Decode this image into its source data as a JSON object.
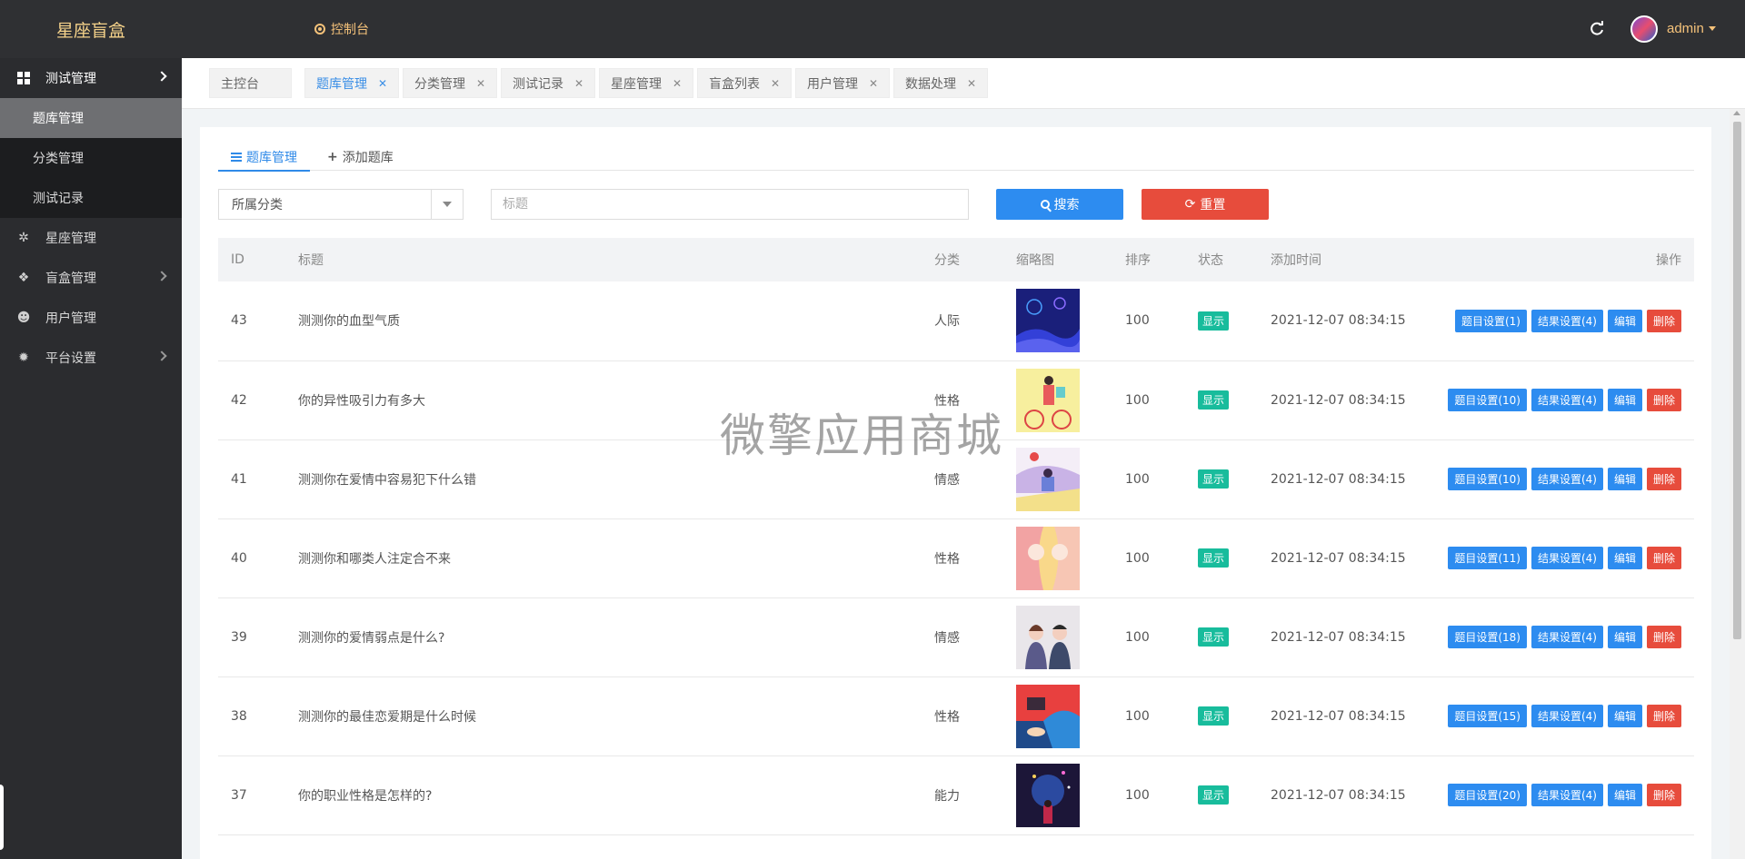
{
  "header": {
    "brand": "星座盲盒",
    "console_label": "控制台",
    "user_name": "admin"
  },
  "sidebar": {
    "items": [
      {
        "label": "测试管理",
        "icon": "grid-icon"
      },
      {
        "label": "星座管理",
        "icon": "star-icon"
      },
      {
        "label": "盲盒管理",
        "icon": "boxes-icon"
      },
      {
        "label": "用户管理",
        "icon": "users-icon"
      },
      {
        "label": "平台设置",
        "icon": "gear-icon"
      }
    ],
    "sub_items": [
      "题库管理",
      "分类管理",
      "测试记录"
    ]
  },
  "tabs": [
    "主控台",
    "题库管理",
    "分类管理",
    "测试记录",
    "星座管理",
    "盲盒列表",
    "用户管理",
    "数据处理"
  ],
  "panel": {
    "tab_list": "题库管理",
    "tab_add": "添加题库",
    "category_select": "所属分类",
    "title_placeholder": "标题",
    "search_label": "搜索",
    "reset_label": "重置"
  },
  "table": {
    "headers": [
      "ID",
      "标题",
      "分类",
      "缩略图",
      "排序",
      "状态",
      "添加时间",
      "操作"
    ],
    "rows": [
      {
        "id": "43",
        "title": "测测你的血型气质",
        "category": "人际",
        "sort": "100",
        "status": "显示",
        "time": "2021-12-07 08:34:15",
        "q": "题目设置(1)",
        "r": "结果设置(4)",
        "edit": "编辑",
        "del": "删除"
      },
      {
        "id": "42",
        "title": "你的异性吸引力有多大",
        "category": "性格",
        "sort": "100",
        "status": "显示",
        "time": "2021-12-07 08:34:15",
        "q": "题目设置(10)",
        "r": "结果设置(4)",
        "edit": "编辑",
        "del": "删除"
      },
      {
        "id": "41",
        "title": "测测你在爱情中容易犯下什么错",
        "category": "情感",
        "sort": "100",
        "status": "显示",
        "time": "2021-12-07 08:34:15",
        "q": "题目设置(10)",
        "r": "结果设置(4)",
        "edit": "编辑",
        "del": "删除"
      },
      {
        "id": "40",
        "title": "测测你和哪类人注定合不来",
        "category": "性格",
        "sort": "100",
        "status": "显示",
        "time": "2021-12-07 08:34:15",
        "q": "题目设置(11)",
        "r": "结果设置(4)",
        "edit": "编辑",
        "del": "删除"
      },
      {
        "id": "39",
        "title": "测测你的爱情弱点是什么?",
        "category": "情感",
        "sort": "100",
        "status": "显示",
        "time": "2021-12-07 08:34:15",
        "q": "题目设置(18)",
        "r": "结果设置(4)",
        "edit": "编辑",
        "del": "删除"
      },
      {
        "id": "38",
        "title": "测测你的最佳恋爱期是什么时候",
        "category": "性格",
        "sort": "100",
        "status": "显示",
        "time": "2021-12-07 08:34:15",
        "q": "题目设置(15)",
        "r": "结果设置(4)",
        "edit": "编辑",
        "del": "删除"
      },
      {
        "id": "37",
        "title": "你的职业性格是怎样的?",
        "category": "能力",
        "sort": "100",
        "status": "显示",
        "time": "2021-12-07 08:34:15",
        "q": "题目设置(20)",
        "r": "结果设置(4)",
        "edit": "编辑",
        "del": "删除"
      }
    ]
  },
  "watermark": "微擎应用商城",
  "colors": {
    "primary": "#2d8cf0",
    "danger": "#e74c3c",
    "success": "#18bc9c",
    "header_bg": "#2f3033",
    "accent": "#f5c27a"
  }
}
